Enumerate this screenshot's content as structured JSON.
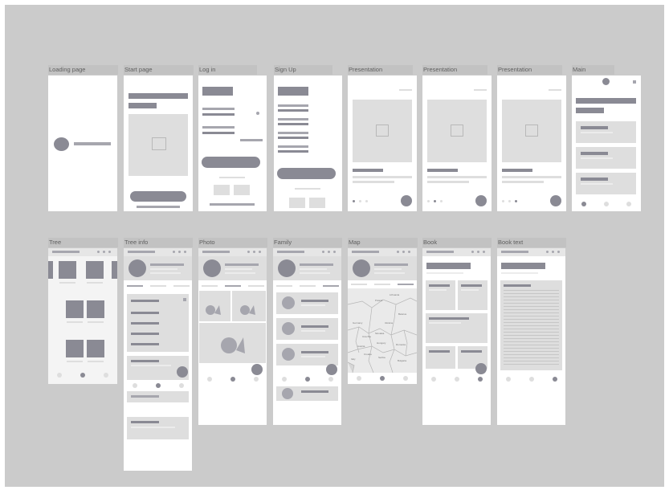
{
  "frames_row1": [
    "Loading page",
    "Start page",
    "Log in",
    "Sign Up",
    "Presentation",
    "Presentation",
    "Presentation",
    "Main"
  ],
  "frames_row2": [
    "Tree",
    "Tree info",
    "Photo",
    "Family",
    "Map",
    "Book",
    "Book text"
  ],
  "map_labels": [
    "Poland",
    "Germany",
    "Belarus",
    "Ukraine",
    "Czechia",
    "Austria",
    "Hungary",
    "Romania",
    "Serbia",
    "Bulgaria",
    "Italy",
    "Croatia",
    "Slovakia",
    "Lithuania"
  ],
  "colors": {
    "canvas": "#cbcbcb",
    "screen": "#ffffff",
    "block_dark": "#8a8a94",
    "block_light": "#dedede"
  }
}
